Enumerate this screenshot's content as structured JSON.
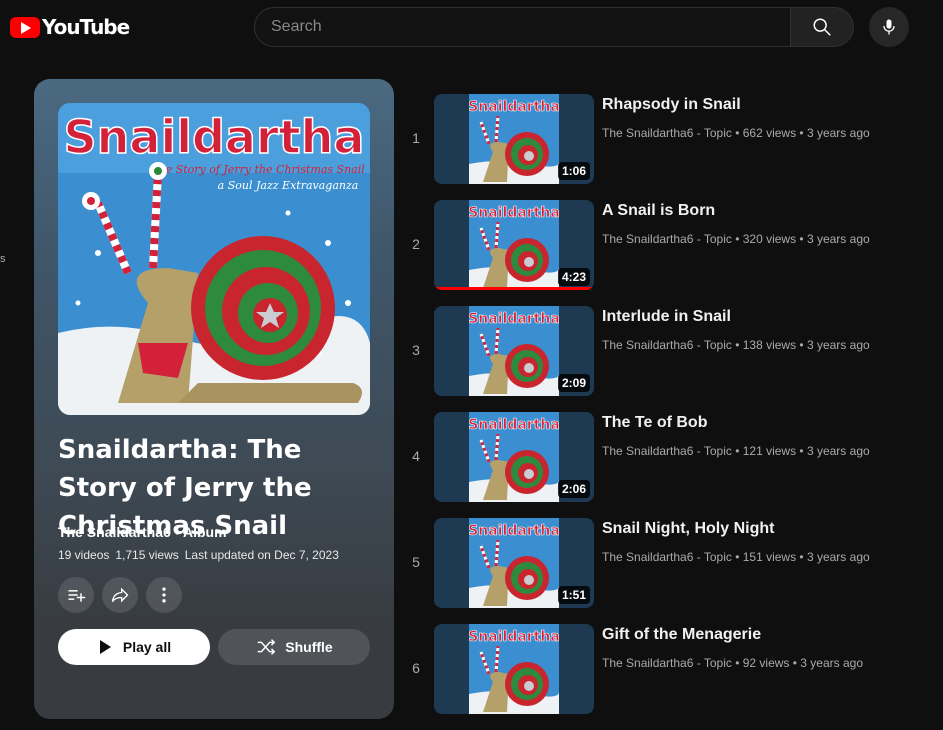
{
  "header": {
    "logo_text": "YouTube",
    "search_placeholder": "Search"
  },
  "edge_text": "s",
  "playlist": {
    "cover_title": "Snaildartha",
    "cover_subtitle_1": "The Story of Jerry the Christmas Snail",
    "cover_subtitle_2": "a Soul Jazz Extravaganza",
    "title": "Snaildartha: The Story of Jerry the Christmas Snail",
    "owner": "The Snaildartha6 • Album",
    "video_count": "19 videos",
    "view_count": "1,715 views",
    "updated": "Last updated on Dec 7, 2023",
    "play_all_label": "Play all",
    "shuffle_label": "Shuffle"
  },
  "videos": [
    {
      "index": "1",
      "title": "Rhapsody in Snail",
      "meta": "The Snaildartha6 - Topic • 662 views • 3 years ago",
      "duration": "1:06",
      "thumb_title": "Snaildartha",
      "watched": 0
    },
    {
      "index": "2",
      "title": "A Snail is Born",
      "meta": "The Snaildartha6 - Topic • 320 views • 3 years ago",
      "duration": "4:23",
      "thumb_title": "Snaildartha",
      "watched": 1.0
    },
    {
      "index": "3",
      "title": "Interlude in Snail",
      "meta": "The Snaildartha6 - Topic • 138 views • 3 years ago",
      "duration": "2:09",
      "thumb_title": "Snaildartha",
      "watched": 0
    },
    {
      "index": "4",
      "title": "The Te of Bob",
      "meta": "The Snaildartha6 - Topic • 121 views • 3 years ago",
      "duration": "2:06",
      "thumb_title": "Snaildartha",
      "watched": 0
    },
    {
      "index": "5",
      "title": "Snail Night, Holy Night",
      "meta": "The Snaildartha6 - Topic • 151 views • 3 years ago",
      "duration": "1:51",
      "thumb_title": "Snaildartha",
      "watched": 0
    },
    {
      "index": "6",
      "title": "Gift of the Menagerie",
      "meta": "The Snaildartha6 - Topic • 92 views • 3 years ago",
      "duration": "",
      "thumb_title": "Snaildartha",
      "watched": 0
    }
  ],
  "colors": {
    "accent": "#ff0000",
    "background": "#0f0f0f",
    "cover_sky": "#3b8fd0",
    "cover_title": "#d3213a"
  }
}
